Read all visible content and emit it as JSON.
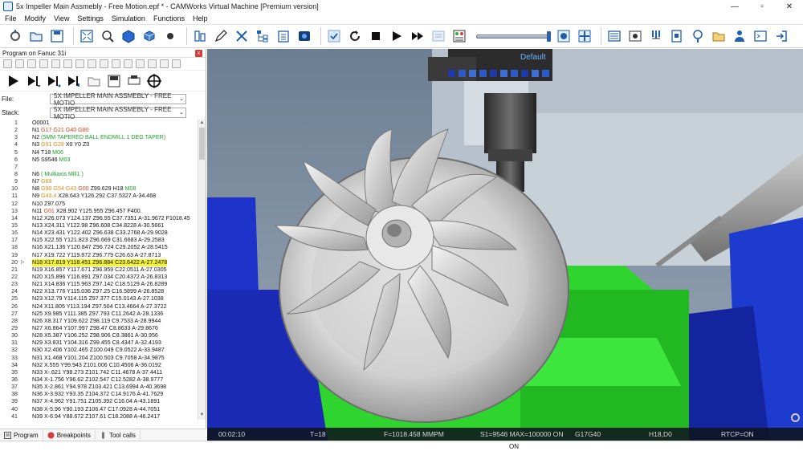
{
  "window": {
    "title": "5x Impeller Main Assmebly - Free Motion.epf * - CAMWorks Virtual Machine [Premium version]",
    "minimize": "—",
    "maximize": "▫",
    "close": "✕"
  },
  "menu": {
    "items": [
      "File",
      "Modify",
      "View",
      "Settings",
      "Simulation",
      "Functions",
      "Help"
    ]
  },
  "panel": {
    "title": "Program on Fanuc 31i",
    "close": "x",
    "file_label": "File:",
    "file_value": "5X IMPELLER MAIN ASSMEBLY - FREE MOTIO",
    "stack_label": "Stack:",
    "stack_value": "5X IMPELLER MAIN ASSMEBLY - FREE MOTIO",
    "dropdown_glyph": "⌄"
  },
  "code_lines": [
    {
      "n": "1",
      "segs": [
        [
          "O0001",
          ""
        ]
      ]
    },
    {
      "n": "2",
      "segs": [
        [
          "N1 ",
          ""
        ],
        [
          "G17 G21 G40 G80",
          "r"
        ]
      ]
    },
    {
      "n": "3",
      "segs": [
        [
          "N2 ",
          ""
        ],
        [
          "(5MM TAPERED BALL ENDMILL 1 DEG TAPER)",
          "g"
        ]
      ]
    },
    {
      "n": "4",
      "segs": [
        [
          "N3 ",
          ""
        ],
        [
          "G91 G28",
          "o"
        ],
        [
          " X0 Y0 Z0",
          ""
        ]
      ]
    },
    {
      "n": "5",
      "segs": [
        [
          "N4 T18 ",
          ""
        ],
        [
          "M06",
          "g"
        ]
      ]
    },
    {
      "n": "6",
      "segs": [
        [
          "N5 S9546 ",
          ""
        ],
        [
          "M03",
          "g"
        ]
      ]
    },
    {
      "n": "7",
      "segs": [
        [
          "",
          ""
        ]
      ]
    },
    {
      "n": "8",
      "segs": [
        [
          "N6 ",
          ""
        ],
        [
          "( Multiaxis Mill1 )",
          "g"
        ]
      ]
    },
    {
      "n": "9",
      "segs": [
        [
          "N7 ",
          ""
        ],
        [
          "G69",
          "o"
        ]
      ]
    },
    {
      "n": "10",
      "segs": [
        [
          "N8 ",
          ""
        ],
        [
          "G90 G54 G43",
          "o"
        ],
        [
          " ",
          ""
        ],
        [
          "G00",
          "r"
        ],
        [
          " Z99.629 H18 ",
          ""
        ],
        [
          "M08",
          "g"
        ]
      ]
    },
    {
      "n": "11",
      "segs": [
        [
          "N9 ",
          ""
        ],
        [
          "G43.4",
          "o"
        ],
        [
          " X28.643 Y126.292 C37.5327 A-34.468",
          ""
        ]
      ]
    },
    {
      "n": "12",
      "segs": [
        [
          "N10 Z97.075",
          ""
        ]
      ]
    },
    {
      "n": "13",
      "segs": [
        [
          "N11 ",
          ""
        ],
        [
          "G01",
          "r"
        ],
        [
          " X28.902 Y125.955 Z96.457 F400.",
          ""
        ]
      ]
    },
    {
      "n": "14",
      "segs": [
        [
          "N12 X26.073 Y124.137 Z96.55 C37.7351 A-31.9672 F1018.45",
          ""
        ]
      ]
    },
    {
      "n": "15",
      "segs": [
        [
          "N13 X24.311 Y122.98 Z96.608 C34.8228 A-30.5661",
          ""
        ]
      ]
    },
    {
      "n": "16",
      "segs": [
        [
          "N14 X23.431 Y122.402 Z96.638 C33.2768 A-29.9028",
          ""
        ]
      ]
    },
    {
      "n": "17",
      "segs": [
        [
          "N15 X22.55 Y121.823 Z96.669 C31.6683 A-29.2583",
          ""
        ]
      ]
    },
    {
      "n": "18",
      "segs": [
        [
          "N16 X21.136 Y120.847 Z96.724 C29.2052 A-28.5415",
          ""
        ]
      ]
    },
    {
      "n": "19",
      "segs": [
        [
          "N17 X19.722 Y119.872 Z96.779 C26.63 A-27.8713",
          ""
        ]
      ]
    },
    {
      "n": "20",
      "segs": [
        [
          "N18 X17.819 Y118.451 Z96.884 C23.6422 A-27.2478",
          ""
        ]
      ],
      "hl": true
    },
    {
      "n": "21",
      "segs": [
        [
          "N19 X16.857 Y117.671 Z96.959 C22.0511 A-27.0305",
          ""
        ]
      ]
    },
    {
      "n": "22",
      "segs": [
        [
          "N20 X15.896 Y116.891 Z97.034 C20.4372 A-26.8313",
          ""
        ]
      ]
    },
    {
      "n": "23",
      "segs": [
        [
          "N21 X14.836 Y115.963 Z97.142 C18.5129 A-26.8289",
          ""
        ]
      ]
    },
    {
      "n": "24",
      "segs": [
        [
          "N22 X13.776 Y115.036 Z97.25 C16.5899 A-26.8528",
          ""
        ]
      ]
    },
    {
      "n": "25",
      "segs": [
        [
          "N23 X12.79 Y114.115 Z97.377 C15.0143 A-27.1038",
          ""
        ]
      ]
    },
    {
      "n": "26",
      "segs": [
        [
          "N24 X11.805 Y113.194 Z97.504 C13.4664 A-27.3722",
          ""
        ]
      ]
    },
    {
      "n": "27",
      "segs": [
        [
          "N25 X9.985 Y111.385 Z97.793 C11.2642 A-28.1336",
          ""
        ]
      ]
    },
    {
      "n": "28",
      "segs": [
        [
          "N26 X8.317 Y109.622 Z98.119 C9.7533 A-28.9944",
          ""
        ]
      ]
    },
    {
      "n": "29",
      "segs": [
        [
          "N27 X6.864 Y107.997 Z98.47 C8.8633 A-29.8676",
          ""
        ]
      ]
    },
    {
      "n": "30",
      "segs": [
        [
          "N28 X5.387 Y106.252 Z98.906 C8.3861 A-30.956",
          ""
        ]
      ]
    },
    {
      "n": "31",
      "segs": [
        [
          "N29 X3.831 Y104.316 Z99.455 C8.4347 A-32.4193",
          ""
        ]
      ]
    },
    {
      "n": "32",
      "segs": [
        [
          "N30 X2.406 Y102.465 Z100.049 C9.0522 A-33.9487",
          ""
        ]
      ]
    },
    {
      "n": "33",
      "segs": [
        [
          "N31 X1.468 Y101.204 Z100.503 C9.7058 A-34.9875",
          ""
        ]
      ]
    },
    {
      "n": "34",
      "segs": [
        [
          "N32 X.555 Y99.943 Z101.006 C10.4506 A-36.0192",
          ""
        ]
      ]
    },
    {
      "n": "35",
      "segs": [
        [
          "N33 X-.621 Y98.273 Z101.742 C11.4678 A-37.4411",
          ""
        ]
      ]
    },
    {
      "n": "36",
      "segs": [
        [
          "N34 X-1.756 Y96.62 Z102.547 C12.5282 A-38.9777",
          ""
        ]
      ]
    },
    {
      "n": "37",
      "segs": [
        [
          "N35 X-2.861 Y94.978 Z103.421 C13.6994 A-40.3698",
          ""
        ]
      ]
    },
    {
      "n": "38",
      "segs": [
        [
          "N36 X-3.932 Y93.35 Z104.372 C14.9176 A-41.7629",
          ""
        ]
      ]
    },
    {
      "n": "39",
      "segs": [
        [
          "N37 X-4.962 Y91.751 Z105.392 C16.04 A-43.1891",
          ""
        ]
      ]
    },
    {
      "n": "40",
      "segs": [
        [
          "N38 X-5.96 Y90.193 Z106.47 C17.0928 A-44.7051",
          ""
        ]
      ]
    },
    {
      "n": "41",
      "segs": [
        [
          "N39 X-6.94 Y88.672 Z107.61 C18.2088 A-46.2417",
          ""
        ]
      ]
    }
  ],
  "scrollbar": {
    "up": "▲",
    "down": "▼"
  },
  "tabs": {
    "program": "Program",
    "breakpoints": "Breakpoints",
    "toolcalls": "Tool calls"
  },
  "viewport": {
    "view_name": "Default"
  },
  "status": {
    "time": "00:02:10",
    "tool": "T=18",
    "feed": "F=1018.458 MMPM",
    "speed": "S1=9546 MAX=100000 ON",
    "plane": "G17G40",
    "offsets": "H18,D0",
    "rtcp": "RTCP=ON"
  },
  "footer": {
    "on": "ON"
  },
  "colors": {
    "accent_blue": "#1f5fb0",
    "highlight_yellow": "#f5f23a",
    "fixture_green": "#2dd62d",
    "machine_blue": "#1e3bd0"
  }
}
